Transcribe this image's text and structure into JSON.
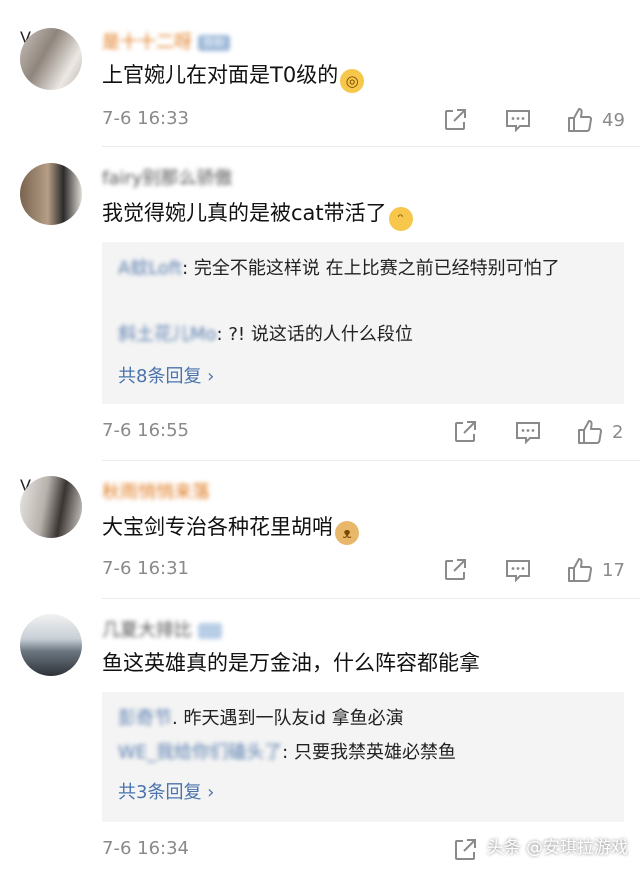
{
  "comments": [
    {
      "username": "是十十二呀",
      "badge": "铁粉",
      "text": "上官婉儿在对面是T0级的",
      "emoji": "dizzy-face",
      "time": "7-6 16:33",
      "likes": "49",
      "verified": true
    },
    {
      "username": "fairy别那么骄傲",
      "text": "我觉得婉儿真的是被cat带活了",
      "emoji": "laugh-cry",
      "replies": [
        {
          "name": "A蚊Loft",
          "text": ": 完全不能这样说 在上比赛之前已经特别可怕了"
        },
        {
          "name": "斜土花儿Mo",
          "text": ": ?! 说这话的人什么段位"
        }
      ],
      "more_replies": "共8条回复 ›",
      "time": "7-6 16:55",
      "likes": "2"
    },
    {
      "username": "秋雨悄悄来落",
      "text": "大宝剑专治各种花里胡哨",
      "emoji": "doge",
      "time": "7-6 16:31",
      "likes": "17",
      "verified": true
    },
    {
      "username": "几夏大排比",
      "text": "鱼这英雄真的是万金油，什么阵容都能拿",
      "replies": [
        {
          "name": "彭奇节",
          "text": ". 昨天遇到一队友id 拿鱼必演"
        },
        {
          "name": "WE_我给你们磕头了",
          "text": ": 只要我禁英雄必禁鱼"
        }
      ],
      "more_replies": "共3条回复 ›",
      "time": "7-6 16:34"
    }
  ],
  "watermark": "头条 @安琪拉游戏",
  "colors": {
    "username": "#e07a1f",
    "reply_name": "#5a7fb0",
    "link": "#4a73ad",
    "meta": "#8a8a8a"
  }
}
